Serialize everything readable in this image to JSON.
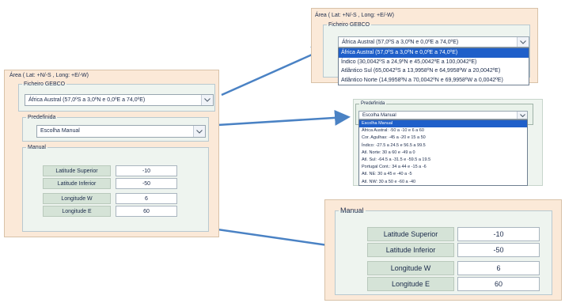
{
  "colors": {
    "panel": "#fbe9d8",
    "group": "#eef4ef",
    "selection": "#1f5fc9",
    "arrow": "#4a82c4"
  },
  "area_title": "Área ( Lat: +N/-S , Long: +E/-W)",
  "gebco": {
    "legend": "Ficheiro GEBCO",
    "selected": "África Austral (57,0ºS a 3,0ºN e 0,0ºE a 74,0ºE)",
    "options": [
      "África Austral (57,0ºS a 3,0ºN e 0,0ºE a 74,0ºE)",
      "Índico (30,0042ºS a 24,9ºN e 45,0042ºE a 100,0042ºE)",
      "Atlântico Sul (65,0042ºS a 13,9958ºN e 64,9958ºW a 20,0042ºE)",
      "Atlântico Norte (14,9958ºN a 70,0042ºN e 69,9958ºW a 0,0042ºE)"
    ]
  },
  "predefinida": {
    "legend": "Predefinida",
    "selected": "Escolha Manual",
    "options": [
      "Escolha Manual",
      "África Austral: -50 a -10 e 6 a 60",
      "Cor. Agulhas: -45 a -20 e 15 a 50",
      "Índico: -27.5 a 24.5 e 56.5 a 99.5",
      "Atl. Norte: 30 a 60 e -49 a 0",
      "Atl. Sul: -64.5 a -31.5 e -59.5 a 19.5",
      "Portugal Cont.: 34 a 44 e -15 a -6",
      "Atl. NE: 30 a 45 e -40 a -5",
      "Atl. NW: 30 a 50 e -60 a -40"
    ]
  },
  "manual": {
    "legend": "Manual",
    "fields": [
      {
        "label": "Latitude Superior",
        "value": "-10"
      },
      {
        "label": "Latitude Inferior",
        "value": "-50"
      },
      {
        "label": "Longitude W",
        "value": "6"
      },
      {
        "label": "Longitude E",
        "value": "60"
      }
    ]
  }
}
